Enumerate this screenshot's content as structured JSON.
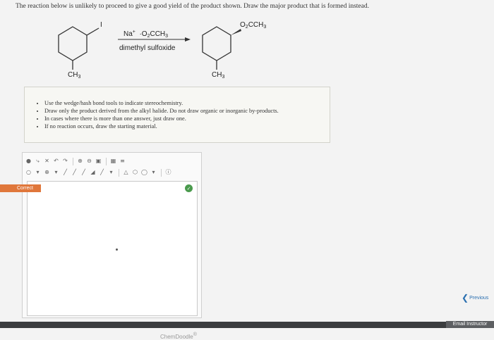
{
  "question": "The reaction below is unlikely to proceed to give a good yield of the product shown. Draw the major product that is formed instead.",
  "reaction": {
    "reactant_iodine": "I",
    "reactant_methyl": "CH",
    "reactant_methyl_sub": "3",
    "reagent_cation": "Na",
    "reagent_cation_sup": "+",
    "reagent_anion_pre": "·O",
    "reagent_anion_sub1": "2",
    "reagent_anion_post": "CCH",
    "reagent_anion_sub2": "3",
    "solvent": "dimethyl sulfoxide",
    "product_ester_pre": "O",
    "product_ester_sub1": "2",
    "product_ester_post": "CCH",
    "product_ester_sub2": "3",
    "product_methyl": "CH",
    "product_methyl_sub": "3"
  },
  "instructions": [
    "Use the wedge/hash bond tools to indicate stereochemistry.",
    "Draw only the product derived from the alkyl halide. Do not draw organic or inorganic by-products.",
    "In cases where there is more than one answer, just draw one.",
    "If no reaction occurs, draw the starting material."
  ],
  "editor": {
    "brand": "ChemDoodle",
    "brand_mark": "®",
    "status_icon": "check-icon"
  },
  "status": {
    "correct_label": "Correct"
  },
  "nav": {
    "previous_label": "Previous"
  },
  "footer": {
    "email_label": "Email Instructor"
  },
  "colors": {
    "correct": "#e0773b",
    "link": "#2a6fb0",
    "check": "#4a9a4d"
  }
}
